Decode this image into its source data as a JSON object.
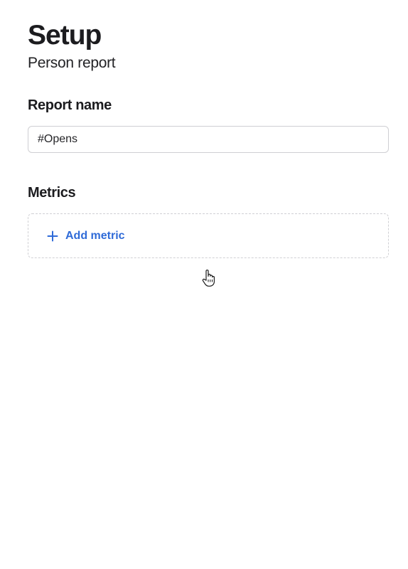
{
  "header": {
    "title": "Setup",
    "subtitle": "Person report"
  },
  "report_name": {
    "label": "Report name",
    "value": "#Opens"
  },
  "metrics": {
    "label": "Metrics",
    "add_button_label": "Add metric",
    "add_icon": "plus-icon"
  },
  "cursor": {
    "icon": "pointer-hand-icon"
  },
  "colors": {
    "accent": "#2f6bd8",
    "text": "#1c1c1f",
    "border": "#cfcfd3"
  }
}
